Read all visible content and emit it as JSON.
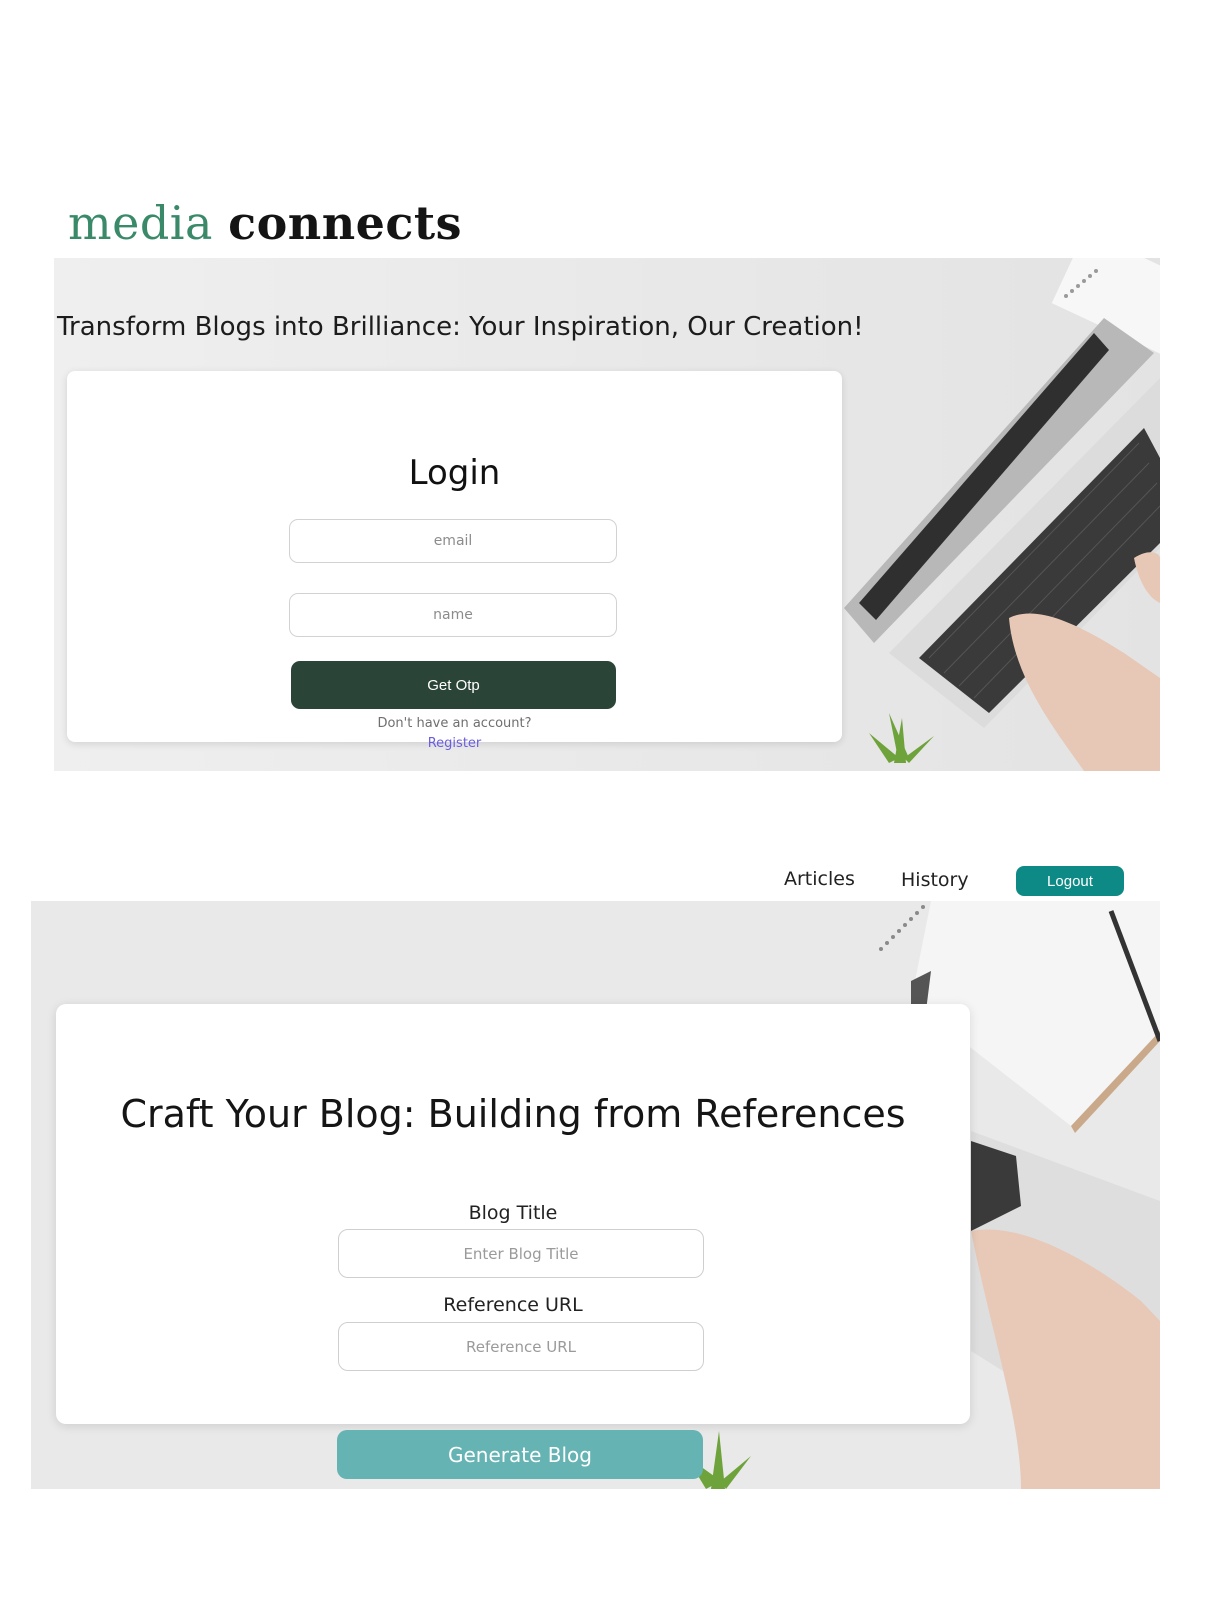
{
  "brand": {
    "part1": "media",
    "part2": "connects"
  },
  "login_section": {
    "tagline": "Transform Blogs into Brilliance: Your Inspiration, Our Creation!",
    "title": "Login",
    "email_placeholder": "email",
    "name_placeholder": "name",
    "submit_label": "Get Otp",
    "no_account_text": "Don't have an account?",
    "register_link": "Register"
  },
  "nav": {
    "items": [
      {
        "label": "Articles"
      },
      {
        "label": "History"
      }
    ],
    "logout_label": "Logout"
  },
  "blog_form": {
    "title": "Craft Your Blog: Building from References",
    "fields": [
      {
        "label": "Blog Title",
        "placeholder": "Enter Blog Title"
      },
      {
        "label": "Reference URL",
        "placeholder": "Reference URL"
      }
    ],
    "submit_label": "Generate Blog"
  },
  "colors": {
    "brand_green": "#3a8a6a",
    "otp_button": "#2b4438",
    "logout_button": "#0e8a86",
    "generate_button": "#66b3b3",
    "register_link": "#6a5de0"
  },
  "icons": [
    "laptop-photo",
    "plant-photo",
    "notebook-photo",
    "pen-photo"
  ]
}
